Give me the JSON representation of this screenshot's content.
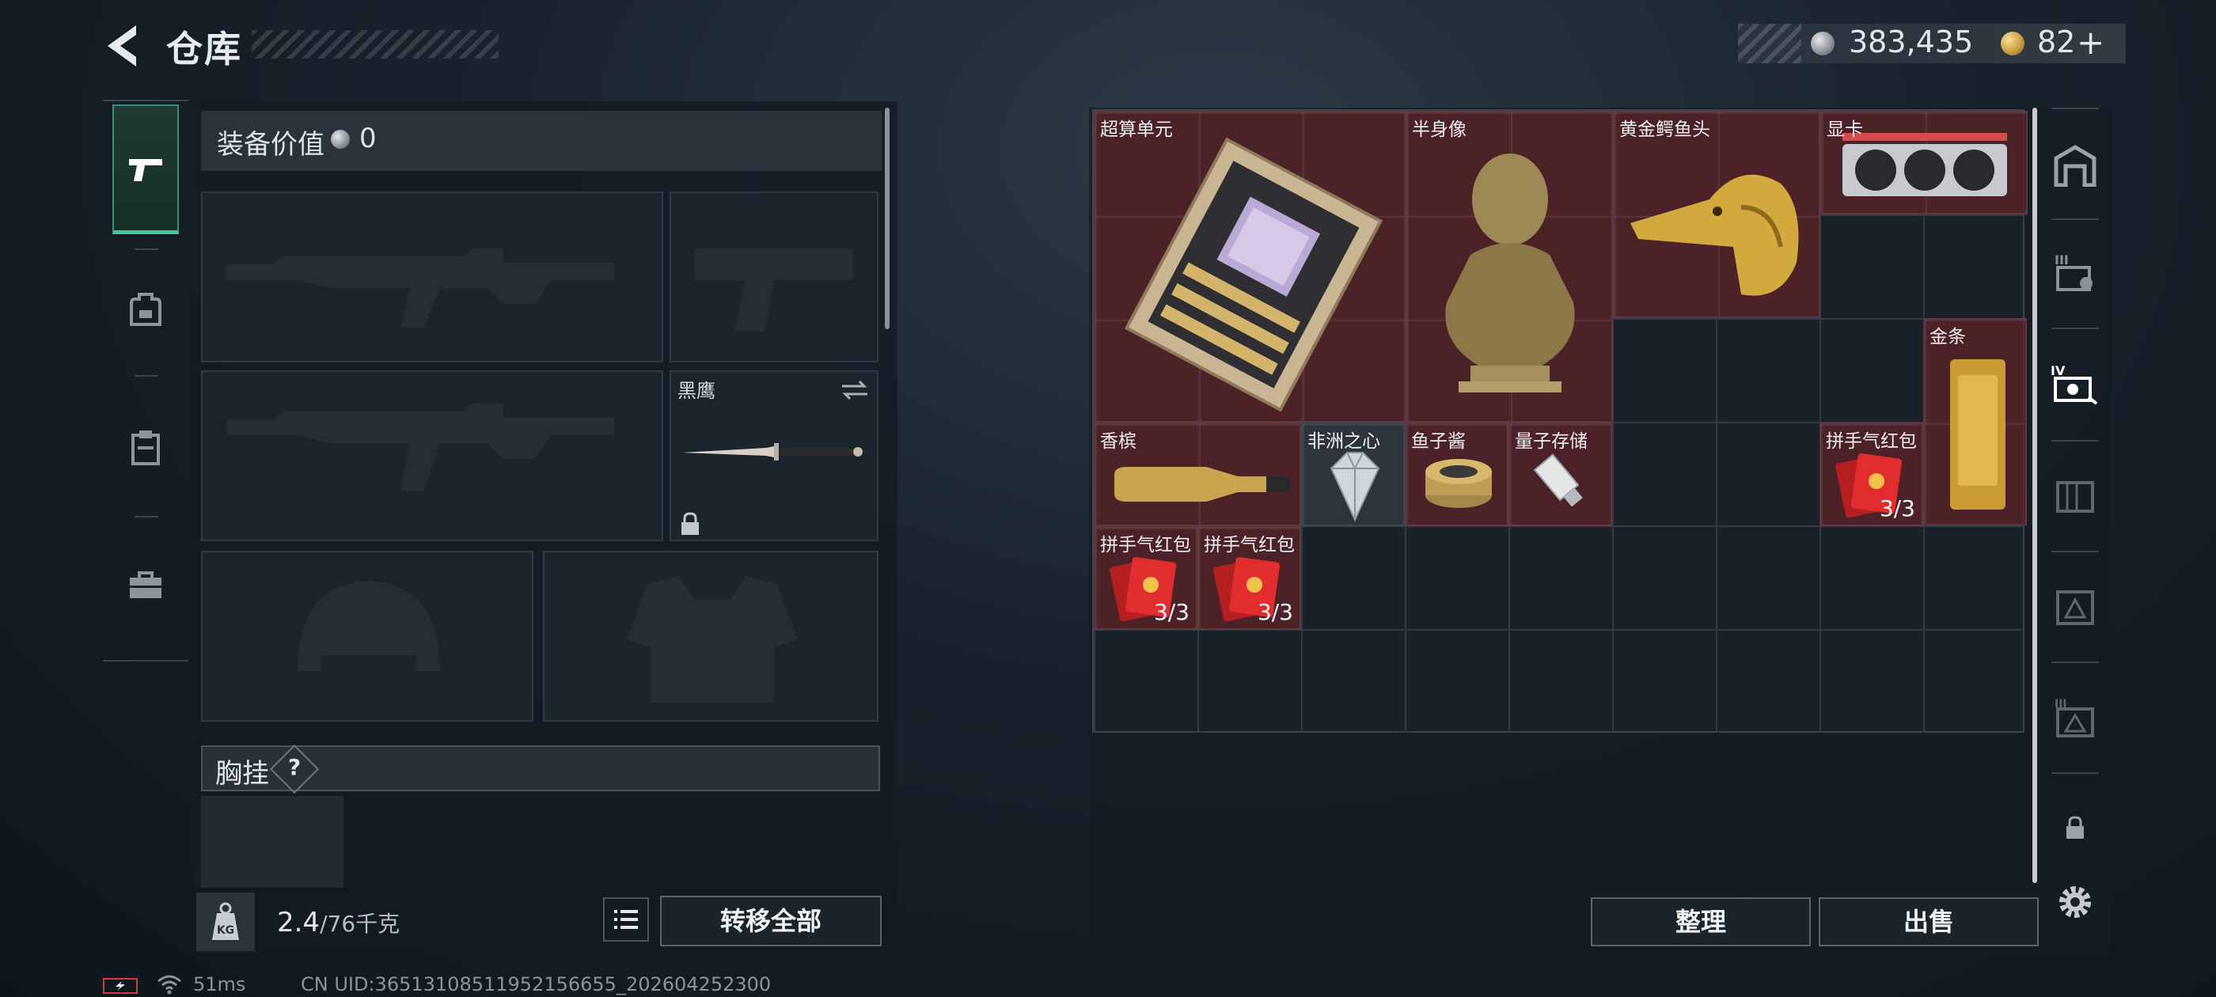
{
  "header": {
    "title": "仓库"
  },
  "currency": {
    "silver_amount": "383,435",
    "gold_amount": "82",
    "gold_add": "+"
  },
  "equipment": {
    "value_label": "装备价值",
    "value_amount": "0",
    "knife_slot_label": "黑鹰",
    "chest_rig_label": "胸挂",
    "chest_rig_help": "?"
  },
  "left_tabs": [
    "pistol-icon",
    "backpack-icon",
    "clipboard-icon",
    "toolbox-icon"
  ],
  "weight": {
    "current": "2.4",
    "capacity": "/76千克"
  },
  "buttons": {
    "transfer_all": "转移全部",
    "sort": "整理",
    "sell": "出售"
  },
  "stash_items": [
    {
      "name": "超算单元",
      "icon": "supercomputer-chip-icon"
    },
    {
      "name": "半身像",
      "icon": "bust-statue-icon"
    },
    {
      "name": "黄金鳄鱼头",
      "icon": "golden-crocodile-head-icon"
    },
    {
      "name": "显卡",
      "icon": "graphics-card-icon"
    },
    {
      "name": "金条",
      "icon": "gold-bar-icon"
    },
    {
      "name": "香槟",
      "icon": "champagne-icon"
    },
    {
      "name": "非洲之心",
      "icon": "diamond-icon"
    },
    {
      "name": "鱼子酱",
      "icon": "caviar-tin-icon"
    },
    {
      "name": "量子存储",
      "icon": "usb-drive-icon"
    },
    {
      "name": "拼手气红包",
      "icon": "red-envelope-icon",
      "count": "3/3"
    },
    {
      "name": "拼手气红包",
      "icon": "red-envelope-icon",
      "count": "3/3"
    },
    {
      "name": "拼手气红包",
      "icon": "red-envelope-icon",
      "count": "3/3"
    }
  ],
  "status": {
    "ping": "51ms",
    "uid": "CN UID:36513108511952156655_202604252300"
  },
  "colors": {
    "accent": "#48c39a",
    "item_red": "#582228",
    "gold": "#c89a3c"
  }
}
